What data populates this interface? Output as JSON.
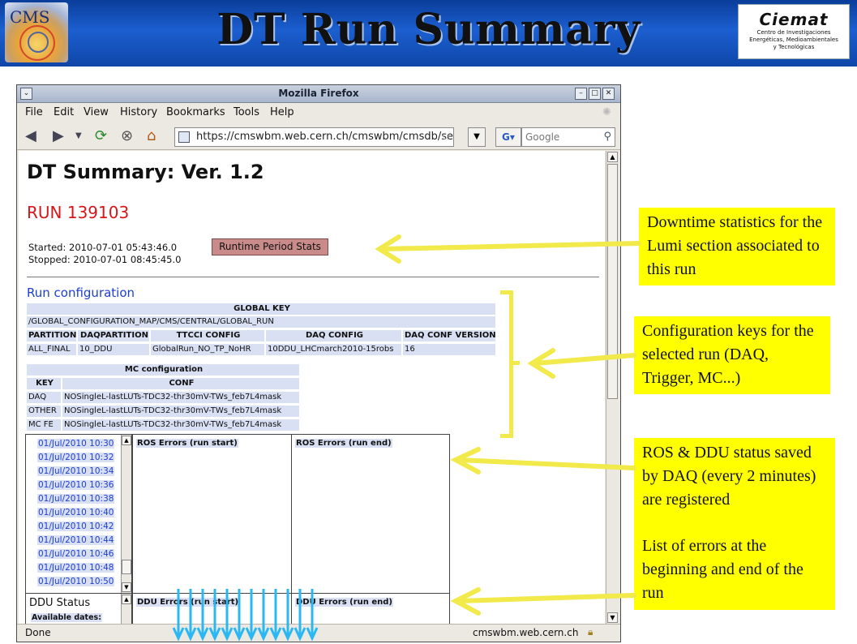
{
  "slide": {
    "title": "DT Run Summary",
    "cms_logo_text": "CMS",
    "ciemat_logo": {
      "name": "Ciemat",
      "subtitle_lines": [
        "Centro de Investigaciones",
        "Energéticas, Medioambientales",
        "y Tecnológicas"
      ]
    }
  },
  "browser": {
    "window_title": "Mozilla Firefox",
    "menu": [
      "File",
      "Edit",
      "View",
      "History",
      "Bookmarks",
      "Tools",
      "Help"
    ],
    "url": "https://cmswbm.web.cern.ch/cmswbm/cmsdb/ser",
    "search_engine": "G",
    "search_placeholder": "Google",
    "status_left": "Done",
    "status_right": "cmswbm.web.cern.ch"
  },
  "page": {
    "heading": "DT Summary: Ver. 1.2",
    "run_label": "RUN 139103",
    "started": "Started: 2010-07-01 05:43:46.0",
    "stopped": "Stopped: 2010-07-01 08:45:45.0",
    "runtime_button": "Runtime Period Stats",
    "run_config_heading": "Run configuration",
    "global_key_header": "GLOBAL KEY",
    "global_key_value": "/GLOBAL_CONFIGURATION_MAP/CMS/CENTRAL/GLOBAL_RUN",
    "config_headers": [
      "PARTITION",
      "DAQPARTITION",
      "TTCCI CONFIG",
      "DAQ CONFIG",
      "DAQ CONF VERSION"
    ],
    "config_values": [
      "ALL_FINAL",
      "10_DDU",
      "GlobalRun_NO_TP_NoHR",
      "10DDU_LHCmarch2010-15robs",
      "16"
    ],
    "mc_header": "MC configuration",
    "mc_col_headers": [
      "KEY",
      "CONF"
    ],
    "mc_rows": [
      {
        "key": "DAQ",
        "conf": "NOSingleL-lastLUTs-TDC32-thr30mV-TWs_feb7L4mask"
      },
      {
        "key": "OTHER",
        "conf": "NOSingleL-lastLUTs-TDC32-thr30mV-TWs_feb7L4mask"
      },
      {
        "key": "MC FE",
        "conf": "NOSingleL-lastLUTs-TDC32-thr30mV-TWs_feb7L4mask"
      }
    ],
    "dates": [
      "01/Jul/2010 10:30",
      "01/Jul/2010 10:32",
      "01/Jul/2010 10:34",
      "01/Jul/2010 10:36",
      "01/Jul/2010 10:38",
      "01/Jul/2010 10:40",
      "01/Jul/2010 10:42",
      "01/Jul/2010 10:44",
      "01/Jul/2010 10:46",
      "01/Jul/2010 10:48",
      "01/Jul/2010 10:50"
    ],
    "ros_start_title": "ROS Errors (run start)",
    "ros_end_title": "ROS Errors (run end)",
    "ddu_status_title": "DDU Status",
    "available_dates_label": "Available dates:",
    "ddu_start_title": "DDU Errors (run start)",
    "ddu_end_title": "DDU Errors (run end)"
  },
  "annotations": {
    "downtime": "Downtime statistics for the Lumi section associated to this run",
    "config_keys": "Configuration keys for the selected run (DAQ, Trigger, MC...)",
    "ros_ddu_line1": "ROS & DDU status saved by DAQ (every 2 minutes) are registered",
    "ros_ddu_line2": "List of errors at the beginning and end of the run",
    "highlight_color": "#ffff00",
    "arrow_color": "#f2e94a",
    "blue_arrow_color": "#2bb8f2"
  }
}
